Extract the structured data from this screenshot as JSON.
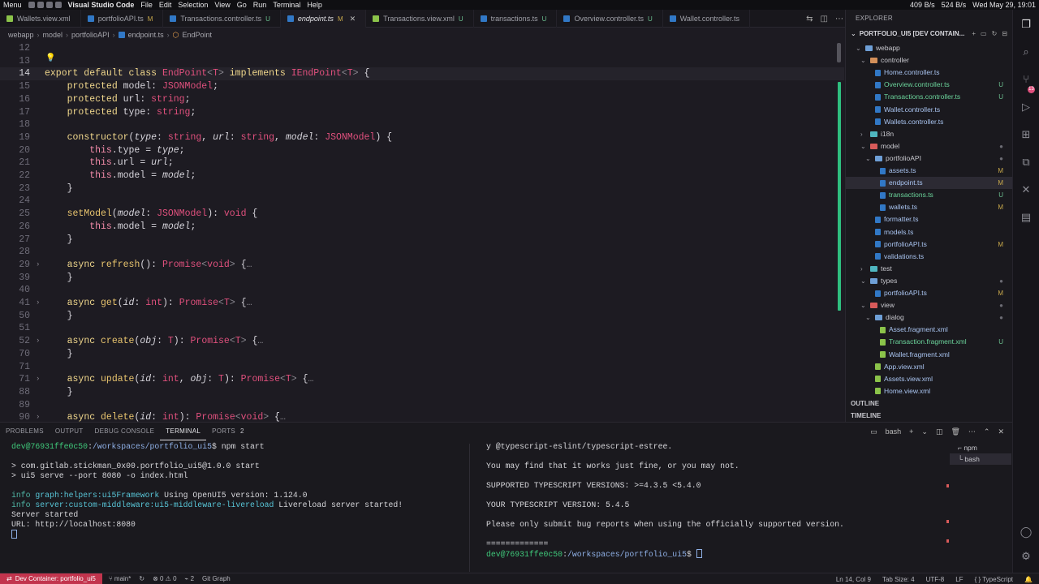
{
  "menubar": {
    "menu": "Menu",
    "app": "Visual Studio Code",
    "items": [
      "File",
      "Edit",
      "Selection",
      "View",
      "Go",
      "Run",
      "Terminal",
      "Help"
    ],
    "network": "409 B/s",
    "network2": "524 B/s",
    "datetime": "Wed May 29, 19:01"
  },
  "tabs": [
    {
      "label": "Wallets.view.xml",
      "badge": "",
      "type": "xml"
    },
    {
      "label": "portfolioAPI.ts",
      "badge": "M",
      "type": "ts"
    },
    {
      "label": "Transactions.controller.ts",
      "badge": "U",
      "type": "ts"
    },
    {
      "label": "endpoint.ts",
      "badge": "M",
      "type": "ts",
      "active": true
    },
    {
      "label": "Transactions.view.xml",
      "badge": "U",
      "type": "xml"
    },
    {
      "label": "transactions.ts",
      "badge": "U",
      "type": "ts"
    },
    {
      "label": "Overview.controller.ts",
      "badge": "U",
      "type": "ts"
    },
    {
      "label": "Wallet.controller.ts",
      "badge": "",
      "type": "ts"
    }
  ],
  "breadcrumb": [
    "webapp",
    "model",
    "portfolioAPI",
    "endpoint.ts",
    "EndPoint"
  ],
  "editor": {
    "lines": [
      {
        "n": "12",
        "html": ""
      },
      {
        "n": "13",
        "html": ""
      },
      {
        "n": "14",
        "html": "<span class='k'>export default class</span> <span class='pink'>EndPoint</span><span class='dim'>&lt;</span><span class='tp'>T</span><span class='dim'>&gt;</span> <span class='k'>implements</span> <span class='pink'>IEndPoint</span><span class='dim'>&lt;</span><span class='tp'>T</span><span class='dim'>&gt;</span> {",
        "current": true
      },
      {
        "n": "15",
        "html": "    <span class='k'>protected</span> model: <span class='pink'>JSONModel</span>;"
      },
      {
        "n": "16",
        "html": "    <span class='k'>protected</span> url: <span class='pink'>string</span>;"
      },
      {
        "n": "17",
        "html": "    <span class='k'>protected</span> type: <span class='pink'>string</span>;"
      },
      {
        "n": "18",
        "html": ""
      },
      {
        "n": "19",
        "html": "    <span class='k'>constructor</span>(<span class='it'>type</span>: <span class='pink'>string</span>, <span class='it'>url</span>: <span class='pink'>string</span>, <span class='it'>model</span>: <span class='pink'>JSONModel</span>) {"
      },
      {
        "n": "20",
        "html": "        <span class='th'>this</span>.type = <span class='it'>type</span>;"
      },
      {
        "n": "21",
        "html": "        <span class='th'>this</span>.url = <span class='it'>url</span>;"
      },
      {
        "n": "22",
        "html": "        <span class='th'>this</span>.model = <span class='it'>model</span>;"
      },
      {
        "n": "23",
        "html": "    }"
      },
      {
        "n": "24",
        "html": ""
      },
      {
        "n": "25",
        "html": "    <span class='gold'>setModel</span>(<span class='it'>model</span>: <span class='pink'>JSONModel</span>): <span class='pink'>void</span> {"
      },
      {
        "n": "26",
        "html": "        <span class='th'>this</span>.model = <span class='it'>model</span>;"
      },
      {
        "n": "27",
        "html": "    }"
      },
      {
        "n": "28",
        "html": ""
      },
      {
        "n": "29",
        "html": "    <span class='k'>async</span> <span class='gold'>refresh</span>(): <span class='pink'>Promise</span><span class='dim'>&lt;</span><span class='pink'>void</span><span class='dim'>&gt;</span> {<span class='dim'>…</span>",
        "fold": true
      },
      {
        "n": "39",
        "html": "    }"
      },
      {
        "n": "40",
        "html": ""
      },
      {
        "n": "41",
        "html": "    <span class='k'>async</span> <span class='gold'>get</span>(<span class='it'>id</span>: <span class='pink'>int</span>): <span class='pink'>Promise</span><span class='dim'>&lt;</span><span class='tp'>T</span><span class='dim'>&gt;</span> {<span class='dim'>…</span>",
        "fold": true
      },
      {
        "n": "50",
        "html": "    }"
      },
      {
        "n": "51",
        "html": ""
      },
      {
        "n": "52",
        "html": "    <span class='k'>async</span> <span class='gold'>create</span>(<span class='it'>obj</span>: <span class='tp'>T</span>): <span class='pink'>Promise</span><span class='dim'>&lt;</span><span class='tp'>T</span><span class='dim'>&gt;</span> {<span class='dim'>…</span>",
        "fold": true
      },
      {
        "n": "70",
        "html": "    }"
      },
      {
        "n": "71",
        "html": ""
      },
      {
        "n": "71",
        "html": "    <span class='k'>async</span> <span class='gold'>update</span>(<span class='it'>id</span>: <span class='pink'>int</span>, <span class='it'>obj</span>: <span class='tp'>T</span>): <span class='pink'>Promise</span><span class='dim'>&lt;</span><span class='tp'>T</span><span class='dim'>&gt;</span> {<span class='dim'>…</span>",
        "fold": true
      },
      {
        "n": "88",
        "html": "    }"
      },
      {
        "n": "89",
        "html": ""
      },
      {
        "n": "90",
        "html": "    <span class='k'>async</span> <span class='gold'>delete</span>(<span class='it'>id</span>: <span class='pink'>int</span>): <span class='pink'>Promise</span><span class='dim'>&lt;</span><span class='pink'>void</span><span class='dim'>&gt;</span> {<span class='dim'>…</span>",
        "fold": true
      }
    ]
  },
  "explorer": {
    "title": "EXPLORER",
    "project": "PORTFOLIO_UI5 [DEV CONTAIN...",
    "items": [
      {
        "label": "webapp",
        "kind": "folder",
        "depth": 1,
        "open": true,
        "color": ""
      },
      {
        "label": "controller",
        "kind": "folder",
        "depth": 2,
        "open": true,
        "color": "orange"
      },
      {
        "label": "Home.controller.ts",
        "kind": "ts",
        "depth": 3,
        "stat": ""
      },
      {
        "label": "Overview.controller.ts",
        "kind": "ts",
        "depth": 3,
        "stat": "U"
      },
      {
        "label": "Transactions.controller.ts",
        "kind": "ts",
        "depth": 3,
        "stat": "U"
      },
      {
        "label": "Wallet.controller.ts",
        "kind": "ts",
        "depth": 3,
        "stat": ""
      },
      {
        "label": "Wallets.controller.ts",
        "kind": "ts",
        "depth": 3,
        "stat": ""
      },
      {
        "label": "i18n",
        "kind": "folder",
        "depth": 2,
        "open": false,
        "color": "teal"
      },
      {
        "label": "model",
        "kind": "folder",
        "depth": 2,
        "open": true,
        "color": "red",
        "stat": "dot"
      },
      {
        "label": "portfolioAPI",
        "kind": "folder",
        "depth": 3,
        "open": true,
        "color": "",
        "stat": "dot"
      },
      {
        "label": "assets.ts",
        "kind": "ts",
        "depth": 4,
        "stat": "M"
      },
      {
        "label": "endpoint.ts",
        "kind": "ts",
        "depth": 4,
        "stat": "M",
        "selected": true
      },
      {
        "label": "transactions.ts",
        "kind": "ts",
        "depth": 4,
        "stat": "U"
      },
      {
        "label": "wallets.ts",
        "kind": "ts",
        "depth": 4,
        "stat": "M"
      },
      {
        "label": "formatter.ts",
        "kind": "ts",
        "depth": 3,
        "stat": ""
      },
      {
        "label": "models.ts",
        "kind": "ts",
        "depth": 3,
        "stat": ""
      },
      {
        "label": "portfolioAPI.ts",
        "kind": "ts",
        "depth": 3,
        "stat": "M"
      },
      {
        "label": "validations.ts",
        "kind": "ts",
        "depth": 3,
        "stat": ""
      },
      {
        "label": "test",
        "kind": "folder",
        "depth": 2,
        "open": false,
        "color": "teal"
      },
      {
        "label": "types",
        "kind": "folder",
        "depth": 2,
        "open": true,
        "color": "",
        "stat": "dot"
      },
      {
        "label": "portfolioAPI.ts",
        "kind": "ts",
        "depth": 3,
        "stat": "M"
      },
      {
        "label": "view",
        "kind": "folder",
        "depth": 2,
        "open": true,
        "color": "red",
        "stat": "dot"
      },
      {
        "label": "dialog",
        "kind": "folder",
        "depth": 3,
        "open": true,
        "color": "",
        "stat": "dot"
      },
      {
        "label": "Asset.fragment.xml",
        "kind": "xml",
        "depth": 4,
        "stat": ""
      },
      {
        "label": "Transaction.fragment.xml",
        "kind": "xml",
        "depth": 4,
        "stat": "U"
      },
      {
        "label": "Wallet.fragment.xml",
        "kind": "xml",
        "depth": 4,
        "stat": ""
      },
      {
        "label": "App.view.xml",
        "kind": "xml",
        "depth": 3,
        "stat": ""
      },
      {
        "label": "Assets.view.xml",
        "kind": "xml",
        "depth": 3,
        "stat": ""
      },
      {
        "label": "Home.view.xml",
        "kind": "xml",
        "depth": 3,
        "stat": ""
      }
    ],
    "outline": "OUTLINE",
    "timeline": "TIMELINE"
  },
  "panel": {
    "tabs": [
      "PROBLEMS",
      "OUTPUT",
      "DEBUG CONSOLE",
      "TERMINAL",
      "PORTS"
    ],
    "ports_count": "2",
    "shell": "bash",
    "terminals": [
      "npm",
      "bash"
    ],
    "left_terminal": [
      "<span class='g'>dev@76931ffe0c50</span>:<span class='p'>/workspaces/portfolio_ui5</span>$ npm start",
      "",
      "&gt; com.gitlab.stickman_0x00.portfolio_ui5@1.0.0 start",
      "&gt; ui5 serve --port 8080 -o index.html",
      "",
      "<span class='teal'>info</span> <span class='cyan'>graph:helpers:ui5Framework</span> Using OpenUI5 version: 1.124.0",
      "<span class='teal'>info</span> <span class='cyan'>server:custom-middleware:ui5-middleware-livereload</span> Livereload server started!",
      "Server started",
      "URL: http://localhost:8080",
      "<span class='cursor'></span>"
    ],
    "right_terminal": [
      "y @typescript-eslint/typescript-estree.",
      "",
      "You may find that it works just fine, or you may not.",
      "",
      "SUPPORTED TYPESCRIPT VERSIONS: &gt;=4.3.5 &lt;5.4.0",
      "",
      "YOUR TYPESCRIPT VERSION: 5.4.5",
      "",
      "Please only submit bug reports when using the officially supported version.",
      "",
      "=============",
      "<span class='g'>dev@76931ffe0c50</span>:<span class='p'>/workspaces/portfolio_ui5</span>$ <span class='cursor'></span>"
    ]
  },
  "statusbar": {
    "remote": "Dev Container: portfolio_ui5",
    "branch": "main*",
    "errors": "0",
    "warnings": "0",
    "ports": "2",
    "gitgraph": "Git Graph",
    "position": "Ln 14, Col 9",
    "tabsize": "Tab Size: 4",
    "encoding": "UTF-8",
    "eol": "LF",
    "language": "TypeScript"
  }
}
